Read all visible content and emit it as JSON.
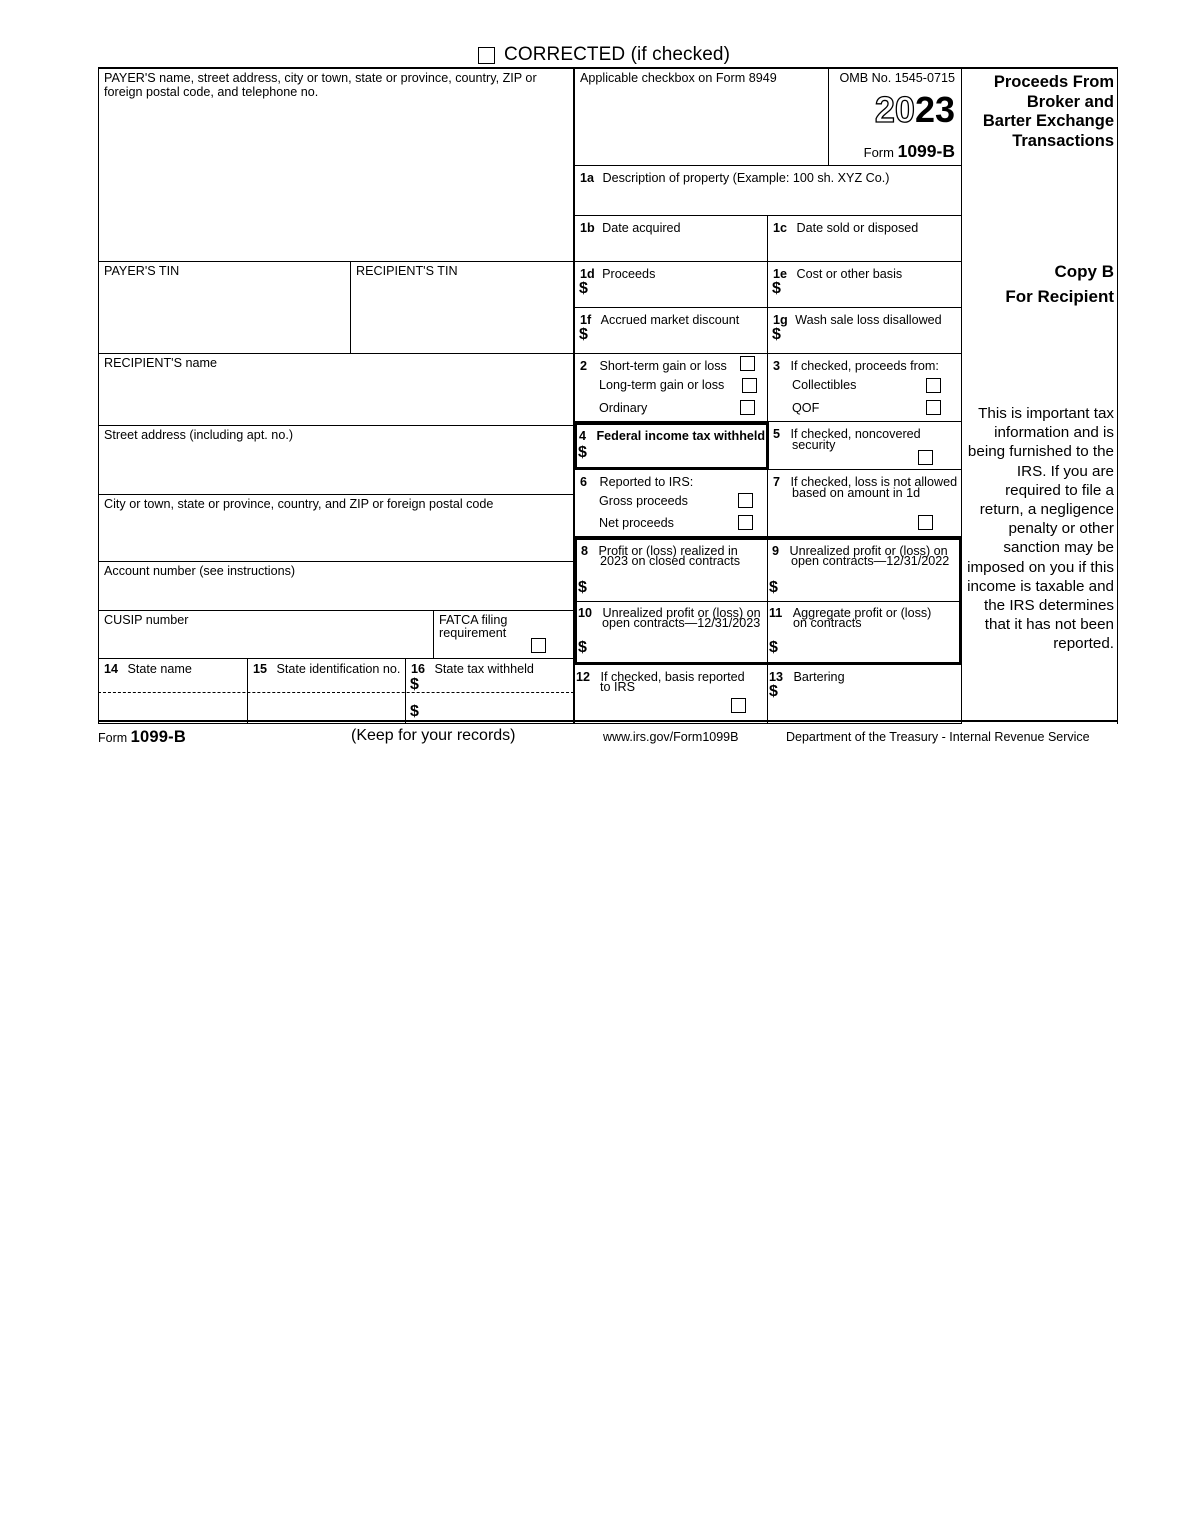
{
  "corrected": {
    "label": "CORRECTED (if checked)",
    "checked": false
  },
  "header": {
    "payer_block_label": "PAYER'S name, street address, city or town, state or province, country, ZIP or foreign postal code, and telephone no.",
    "applicable_checkbox_label": "Applicable checkbox on Form 8949",
    "omb_label": "OMB No. 1545-0715",
    "year_outline": "20",
    "year_solid": "23",
    "form_word": "Form",
    "form_number": "1099-B",
    "title_lines": [
      "Proceeds From",
      "Broker and",
      "Barter Exchange",
      "Transactions"
    ]
  },
  "left_column": {
    "payers_tin": "PAYER'S TIN",
    "recipients_tin": "RECIPIENT'S TIN",
    "recipients_name": "RECIPIENT'S name",
    "street_address": "Street address (including apt. no.)",
    "city_state_zip": "City or town, state or province, country, and ZIP or foreign postal code",
    "account_number": "Account number (see instructions)",
    "cusip_number": "CUSIP number",
    "fatca_line1": "FATCA filing",
    "fatca_line2": "requirement",
    "state_boxes": [
      {
        "num": "14",
        "label": "State name"
      },
      {
        "num": "15",
        "label": "State identification no."
      },
      {
        "num": "16",
        "label": "State tax withheld"
      }
    ],
    "currency_symbol": "$"
  },
  "boxes": {
    "b1a": {
      "num": "1a",
      "label": "Description of property (Example: 100 sh. XYZ Co.)"
    },
    "b1b": {
      "num": "1b",
      "label": "Date acquired"
    },
    "b1c": {
      "num": "1c",
      "label": "Date sold or disposed"
    },
    "b1d": {
      "num": "1d",
      "label": "Proceeds",
      "currency": "$"
    },
    "b1e": {
      "num": "1e",
      "label": "Cost or other basis",
      "currency": "$"
    },
    "b1f": {
      "num": "1f",
      "label": "Accrued market discount",
      "currency": "$"
    },
    "b1g": {
      "num": "1g",
      "label": "Wash sale loss disallowed",
      "currency": "$"
    },
    "b2": {
      "num": "2",
      "options": [
        "Short-term gain or loss",
        "Long-term gain or loss",
        "Ordinary"
      ]
    },
    "b3": {
      "num": "3",
      "label": "If checked, proceeds from:",
      "options": [
        "Collectibles",
        "QOF"
      ]
    },
    "b4": {
      "num": "4",
      "label": "Federal income tax withheld",
      "currency": "$"
    },
    "b5": {
      "num": "5",
      "line1": "If checked, noncovered",
      "line2": "security"
    },
    "b6": {
      "num": "6",
      "label": "Reported to IRS:",
      "options": [
        "Gross proceeds",
        "Net proceeds"
      ]
    },
    "b7": {
      "num": "7",
      "line1": "If checked, loss is not allowed",
      "line2": "based on amount in 1d"
    },
    "b8": {
      "num": "8",
      "line1": "Profit or (loss) realized in",
      "line2": "2023 on closed contracts",
      "currency": "$"
    },
    "b9": {
      "num": "9",
      "line1": "Unrealized profit or (loss) on",
      "line2": "open contracts—12/31/2022",
      "currency": "$"
    },
    "b10": {
      "num": "10",
      "line1": "Unrealized profit or (loss) on",
      "line2": "open contracts—12/31/2023",
      "currency": "$"
    },
    "b11": {
      "num": "11",
      "line1": "Aggregate profit or (loss)",
      "line2": "on contracts",
      "currency": "$"
    },
    "b12": {
      "num": "12",
      "line1": "If checked, basis reported",
      "line2": "to IRS"
    },
    "b13": {
      "num": "13",
      "label": "Bartering",
      "currency": "$"
    }
  },
  "right_column": {
    "copy_line1": "Copy B",
    "copy_line2": "For Recipient",
    "note": "This is important tax information and is being furnished to the IRS. If you are required to file a return, a negligence penalty or other sanction may be imposed on you if this income is taxable and the IRS determines that it has not been reported."
  },
  "footer": {
    "form_word": "Form",
    "form_number": "1099-B",
    "keep": "(Keep for your records)",
    "url": "www.irs.gov/Form1099B",
    "department": "Department of the Treasury - Internal Revenue Service"
  }
}
